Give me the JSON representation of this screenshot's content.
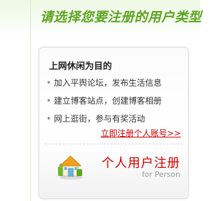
{
  "header": {
    "title": "请选择您要注册的用户类型"
  },
  "card": {
    "heading": "上网休闲为目的",
    "features": [
      {
        "bullet": "•",
        "text": "加入平舆论坛，发布生活信息"
      },
      {
        "bullet": "•",
        "text": "建立博客站点，创建博客相册"
      },
      {
        "bullet": "•",
        "text": "网上逛街，参与有奖活动"
      }
    ],
    "register_link": "立即注册个人账号>>",
    "register_button": {
      "title": "个人用户注册",
      "subtitle": "for Person",
      "icon": "house-icon"
    }
  },
  "colors": {
    "title": "#5aa51e",
    "register_link": "#cc0000",
    "register_title": "#d40000",
    "subtitle": "#9a9a9a"
  }
}
